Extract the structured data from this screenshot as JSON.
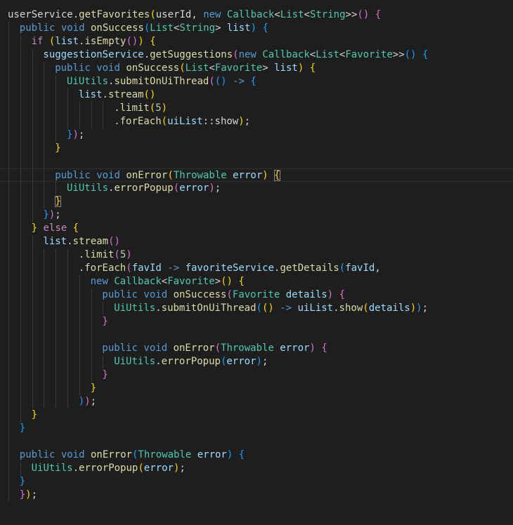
{
  "editor": {
    "theme": {
      "background": "#1e1e1e"
    },
    "current_line": 13,
    "lines": [
      {
        "indent": 0,
        "tokens": [
          [
            "userService",
            "p"
          ],
          [
            ".",
            "p"
          ],
          [
            "getFavorites",
            "fn"
          ],
          [
            "(",
            "b1"
          ],
          [
            "userId",
            "p"
          ],
          [
            ", ",
            "p"
          ],
          [
            "new",
            "kw"
          ],
          [
            " ",
            "p"
          ],
          [
            "Callback",
            "type"
          ],
          [
            "<",
            "p"
          ],
          [
            "List",
            "type"
          ],
          [
            "<",
            "p"
          ],
          [
            "String",
            "type"
          ],
          [
            ">>",
            "p"
          ],
          [
            "()",
            "b2"
          ],
          [
            " ",
            "p"
          ],
          [
            "{",
            "b2"
          ]
        ]
      },
      {
        "indent": 1,
        "tokens": [
          [
            "public",
            "kw"
          ],
          [
            " ",
            "p"
          ],
          [
            "void",
            "kw"
          ],
          [
            " ",
            "p"
          ],
          [
            "onSuccess",
            "fn"
          ],
          [
            "(",
            "b3"
          ],
          [
            "List",
            "type"
          ],
          [
            "<",
            "p"
          ],
          [
            "String",
            "type"
          ],
          [
            ">",
            "p"
          ],
          [
            " list",
            "var"
          ],
          [
            ")",
            "b3"
          ],
          [
            " ",
            "p"
          ],
          [
            "{",
            "b3"
          ]
        ]
      },
      {
        "indent": 2,
        "tokens": [
          [
            "if",
            "ctrl"
          ],
          [
            " ",
            "p"
          ],
          [
            "(",
            "b1"
          ],
          [
            "list",
            "var"
          ],
          [
            ".",
            "p"
          ],
          [
            "isEmpty",
            "fn"
          ],
          [
            "()",
            "b2"
          ],
          [
            ")",
            "b1"
          ],
          [
            " ",
            "p"
          ],
          [
            "{",
            "b1"
          ]
        ]
      },
      {
        "indent": 3,
        "tokens": [
          [
            "suggestionService",
            "var"
          ],
          [
            ".",
            "p"
          ],
          [
            "getSuggestions",
            "fn"
          ],
          [
            "(",
            "b2"
          ],
          [
            "new",
            "kw"
          ],
          [
            " ",
            "p"
          ],
          [
            "Callback",
            "type"
          ],
          [
            "<",
            "p"
          ],
          [
            "List",
            "type"
          ],
          [
            "<",
            "p"
          ],
          [
            "Favorite",
            "type"
          ],
          [
            ">>",
            "p"
          ],
          [
            "()",
            "b3"
          ],
          [
            " ",
            "p"
          ],
          [
            "{",
            "b3"
          ]
        ]
      },
      {
        "indent": 4,
        "tokens": [
          [
            "public",
            "kw"
          ],
          [
            " ",
            "p"
          ],
          [
            "void",
            "kw"
          ],
          [
            " ",
            "p"
          ],
          [
            "onSuccess",
            "fn"
          ],
          [
            "(",
            "b1"
          ],
          [
            "List",
            "type"
          ],
          [
            "<",
            "p"
          ],
          [
            "Favorite",
            "type"
          ],
          [
            ">",
            "p"
          ],
          [
            " list",
            "var"
          ],
          [
            ")",
            "b1"
          ],
          [
            " ",
            "p"
          ],
          [
            "{",
            "b1"
          ]
        ]
      },
      {
        "indent": 5,
        "tokens": [
          [
            "UiUtils",
            "type"
          ],
          [
            ".",
            "p"
          ],
          [
            "submitOnUiThread",
            "fn"
          ],
          [
            "(",
            "b2"
          ],
          [
            "()",
            "b3"
          ],
          [
            " ",
            "p"
          ],
          [
            "->",
            "kw"
          ],
          [
            " ",
            "p"
          ],
          [
            "{",
            "b3"
          ]
        ]
      },
      {
        "indent": 6,
        "tokens": [
          [
            "list",
            "var"
          ],
          [
            ".",
            "p"
          ],
          [
            "stream",
            "fn"
          ],
          [
            "()",
            "b1"
          ]
        ]
      },
      {
        "indent": 9,
        "tokens": [
          [
            ".",
            "p"
          ],
          [
            "limit",
            "fn"
          ],
          [
            "(",
            "b1"
          ],
          [
            "5",
            "num"
          ],
          [
            ")",
            "b1"
          ]
        ]
      },
      {
        "indent": 9,
        "tokens": [
          [
            ".",
            "p"
          ],
          [
            "forEach",
            "fn"
          ],
          [
            "(",
            "b1"
          ],
          [
            "uiList",
            "var"
          ],
          [
            "::",
            "p"
          ],
          [
            "show",
            "p"
          ],
          [
            ")",
            "b1"
          ],
          [
            ";",
            "p"
          ]
        ]
      },
      {
        "indent": 5,
        "tokens": [
          [
            "}",
            "b3"
          ],
          [
            ")",
            "b2"
          ],
          [
            ";",
            "p"
          ]
        ]
      },
      {
        "indent": 4,
        "tokens": [
          [
            "}",
            "b1"
          ]
        ]
      },
      {
        "indent": 0,
        "tokens": []
      },
      {
        "indent": 4,
        "tokens": [
          [
            "public",
            "kw"
          ],
          [
            " ",
            "p"
          ],
          [
            "void",
            "kw"
          ],
          [
            " ",
            "p"
          ],
          [
            "onError",
            "fn"
          ],
          [
            "(",
            "b1"
          ],
          [
            "Throwable",
            "type"
          ],
          [
            " error",
            "var"
          ],
          [
            ")",
            "b1"
          ],
          [
            " ",
            "p"
          ],
          [
            "{",
            "b1m"
          ]
        ]
      },
      {
        "indent": 5,
        "tokens": [
          [
            "UiUtils",
            "type"
          ],
          [
            ".",
            "p"
          ],
          [
            "errorPopup",
            "fn"
          ],
          [
            "(",
            "b2"
          ],
          [
            "error",
            "var"
          ],
          [
            ")",
            "b2"
          ],
          [
            ";",
            "p"
          ]
        ]
      },
      {
        "indent": 4,
        "tokens": [
          [
            "}",
            "b1m"
          ]
        ]
      },
      {
        "indent": 3,
        "tokens": [
          [
            "}",
            "b3"
          ],
          [
            ")",
            "b2"
          ],
          [
            ";",
            "p"
          ]
        ]
      },
      {
        "indent": 2,
        "tokens": [
          [
            "}",
            "b1"
          ],
          [
            " ",
            "p"
          ],
          [
            "else",
            "ctrl"
          ],
          [
            " ",
            "p"
          ],
          [
            "{",
            "b1"
          ]
        ]
      },
      {
        "indent": 3,
        "tokens": [
          [
            "list",
            "var"
          ],
          [
            ".",
            "p"
          ],
          [
            "stream",
            "fn"
          ],
          [
            "()",
            "b2"
          ]
        ]
      },
      {
        "indent": 6,
        "tokens": [
          [
            ".",
            "p"
          ],
          [
            "limit",
            "fn"
          ],
          [
            "(",
            "b2"
          ],
          [
            "5",
            "num"
          ],
          [
            ")",
            "b2"
          ]
        ]
      },
      {
        "indent": 6,
        "tokens": [
          [
            ".",
            "p"
          ],
          [
            "forEach",
            "fn"
          ],
          [
            "(",
            "b2"
          ],
          [
            "favId",
            "var"
          ],
          [
            " ",
            "p"
          ],
          [
            "->",
            "kw"
          ],
          [
            " ",
            "p"
          ],
          [
            "favoriteService",
            "var"
          ],
          [
            ".",
            "p"
          ],
          [
            "getDetails",
            "fn"
          ],
          [
            "(",
            "b3"
          ],
          [
            "favId",
            "var"
          ],
          [
            ",",
            "p"
          ]
        ]
      },
      {
        "indent": 7,
        "tokens": [
          [
            "new",
            "kw"
          ],
          [
            " ",
            "p"
          ],
          [
            "Callback",
            "type"
          ],
          [
            "<",
            "p"
          ],
          [
            "Favorite",
            "type"
          ],
          [
            ">",
            "p"
          ],
          [
            "()",
            "b1"
          ],
          [
            " ",
            "p"
          ],
          [
            "{",
            "b1"
          ]
        ]
      },
      {
        "indent": 8,
        "tokens": [
          [
            "public",
            "kw"
          ],
          [
            " ",
            "p"
          ],
          [
            "void",
            "kw"
          ],
          [
            " ",
            "p"
          ],
          [
            "onSuccess",
            "fn"
          ],
          [
            "(",
            "b2"
          ],
          [
            "Favorite",
            "type"
          ],
          [
            " details",
            "var"
          ],
          [
            ")",
            "b2"
          ],
          [
            " ",
            "p"
          ],
          [
            "{",
            "b2"
          ]
        ]
      },
      {
        "indent": 9,
        "tokens": [
          [
            "UiUtils",
            "type"
          ],
          [
            ".",
            "p"
          ],
          [
            "submitOnUiThread",
            "fn"
          ],
          [
            "(",
            "b3"
          ],
          [
            "()",
            "b1"
          ],
          [
            " ",
            "p"
          ],
          [
            "->",
            "kw"
          ],
          [
            " ",
            "p"
          ],
          [
            "uiList",
            "var"
          ],
          [
            ".",
            "p"
          ],
          [
            "show",
            "fn"
          ],
          [
            "(",
            "b1"
          ],
          [
            "details",
            "var"
          ],
          [
            ")",
            "b1"
          ],
          [
            ")",
            "b3"
          ],
          [
            ";",
            "p"
          ]
        ]
      },
      {
        "indent": 8,
        "tokens": [
          [
            "}",
            "b2"
          ]
        ]
      },
      {
        "indent": 0,
        "tokens": []
      },
      {
        "indent": 8,
        "tokens": [
          [
            "public",
            "kw"
          ],
          [
            " ",
            "p"
          ],
          [
            "void",
            "kw"
          ],
          [
            " ",
            "p"
          ],
          [
            "onError",
            "fn"
          ],
          [
            "(",
            "b2"
          ],
          [
            "Throwable",
            "type"
          ],
          [
            " error",
            "var"
          ],
          [
            ")",
            "b2"
          ],
          [
            " ",
            "p"
          ],
          [
            "{",
            "b2"
          ]
        ]
      },
      {
        "indent": 9,
        "tokens": [
          [
            "UiUtils",
            "type"
          ],
          [
            ".",
            "p"
          ],
          [
            "errorPopup",
            "fn"
          ],
          [
            "(",
            "b3"
          ],
          [
            "error",
            "var"
          ],
          [
            ")",
            "b3"
          ],
          [
            ";",
            "p"
          ]
        ]
      },
      {
        "indent": 8,
        "tokens": [
          [
            "}",
            "b2"
          ]
        ]
      },
      {
        "indent": 7,
        "tokens": [
          [
            "}",
            "b1"
          ]
        ]
      },
      {
        "indent": 6,
        "tokens": [
          [
            ")",
            "b3"
          ],
          [
            ")",
            "b2"
          ],
          [
            ";",
            "p"
          ]
        ]
      },
      {
        "indent": 2,
        "tokens": [
          [
            "}",
            "b1"
          ]
        ]
      },
      {
        "indent": 1,
        "tokens": [
          [
            "}",
            "b3"
          ]
        ]
      },
      {
        "indent": 0,
        "tokens": []
      },
      {
        "indent": 1,
        "tokens": [
          [
            "public",
            "kw"
          ],
          [
            " ",
            "p"
          ],
          [
            "void",
            "kw"
          ],
          [
            " ",
            "p"
          ],
          [
            "onError",
            "fn"
          ],
          [
            "(",
            "b3"
          ],
          [
            "Throwable",
            "type"
          ],
          [
            " error",
            "var"
          ],
          [
            ")",
            "b3"
          ],
          [
            " ",
            "p"
          ],
          [
            "{",
            "b3"
          ]
        ]
      },
      {
        "indent": 2,
        "tokens": [
          [
            "UiUtils",
            "type"
          ],
          [
            ".",
            "p"
          ],
          [
            "errorPopup",
            "fn"
          ],
          [
            "(",
            "b1"
          ],
          [
            "error",
            "var"
          ],
          [
            ")",
            "b1"
          ],
          [
            ";",
            "p"
          ]
        ]
      },
      {
        "indent": 1,
        "tokens": [
          [
            "}",
            "b3"
          ]
        ]
      },
      {
        "indent": 1,
        "tokens": [
          [
            "}",
            "b2"
          ],
          [
            ")",
            "b1"
          ],
          [
            ";",
            "p"
          ]
        ]
      }
    ]
  }
}
